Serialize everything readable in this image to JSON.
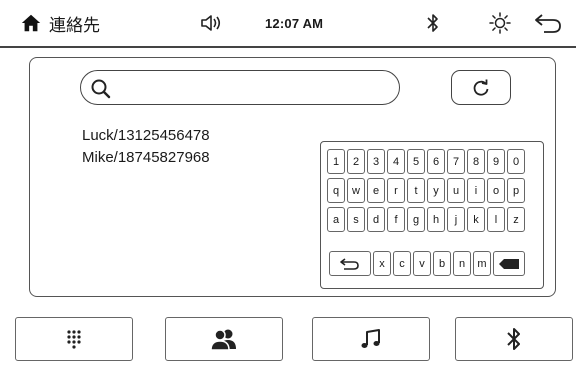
{
  "statusbar": {
    "title": "連絡先",
    "time": "12:07 AM",
    "icons": [
      "home-icon",
      "speaker-icon",
      "bluetooth-icon",
      "brightness-icon",
      "back-icon"
    ]
  },
  "search": {
    "value": "",
    "placeholder": ""
  },
  "contacts": [
    {
      "label": "Luck/13125456478"
    },
    {
      "label": "Mike/18745827968"
    }
  ],
  "keyboard": {
    "row1": [
      "1",
      "2",
      "3",
      "4",
      "5",
      "6",
      "7",
      "8",
      "9",
      "0"
    ],
    "row2": [
      "q",
      "w",
      "e",
      "r",
      "t",
      "y",
      "u",
      "i",
      "o",
      "p"
    ],
    "row3": [
      "a",
      "s",
      "d",
      "f",
      "g",
      "h",
      "j",
      "k",
      "l",
      "z"
    ],
    "row4": [
      "x",
      "c",
      "v",
      "b",
      "n",
      "m"
    ],
    "special_keys": [
      "enter-icon",
      "backspace-icon"
    ]
  },
  "bottom_nav": [
    "dialpad-icon",
    "contacts-icon",
    "music-icon",
    "bluetooth-icon"
  ]
}
